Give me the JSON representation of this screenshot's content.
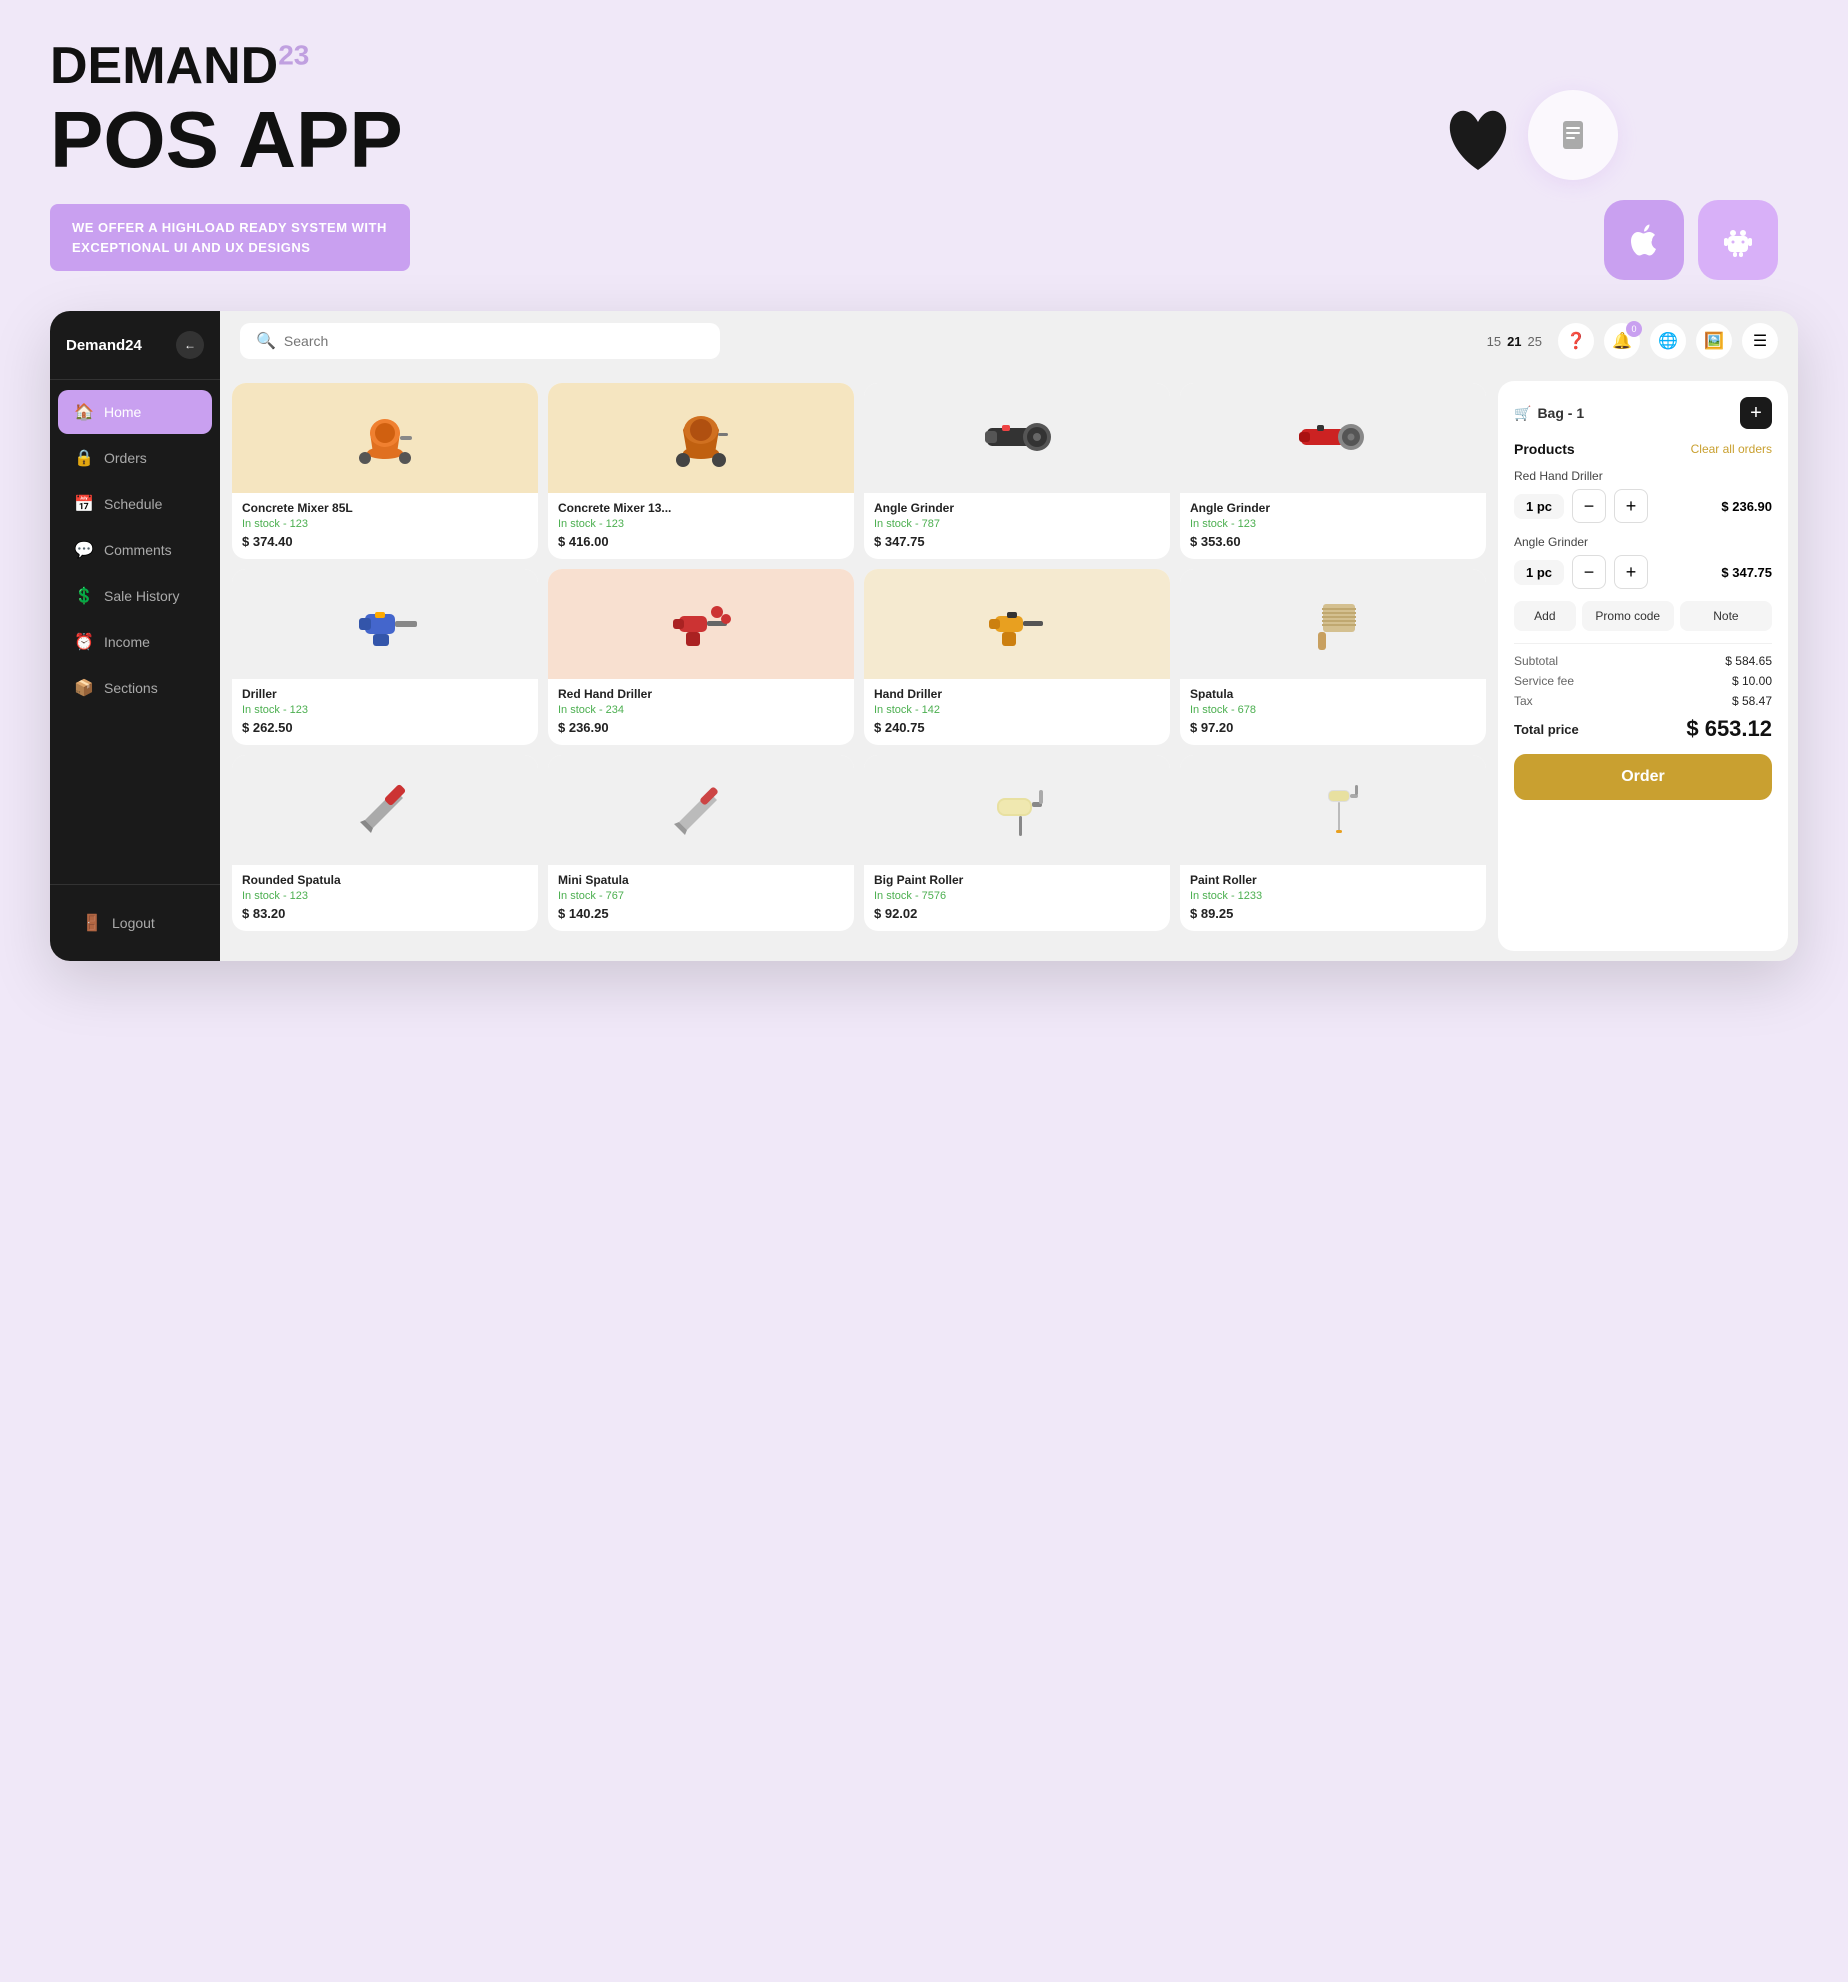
{
  "hero": {
    "brand": "DEMAND",
    "brand_sub": "23",
    "title": "POS APP",
    "tagline": "WE OFFER A HIGHLOAD READY SYSTEM WITH EXCEPTIONAL UI AND UX DESIGNS",
    "apple_icon": "🍎",
    "android_icon": "🤖"
  },
  "app": {
    "sidebar": {
      "brand": "Demand24",
      "nav_items": [
        {
          "id": "home",
          "label": "Home",
          "icon": "🏠",
          "active": true
        },
        {
          "id": "orders",
          "label": "Orders",
          "icon": "🔒"
        },
        {
          "id": "schedule",
          "label": "Schedule",
          "icon": "📅"
        },
        {
          "id": "comments",
          "label": "Comments",
          "icon": "💬"
        },
        {
          "id": "sale-history",
          "label": "Sale History",
          "icon": "💲"
        },
        {
          "id": "income",
          "label": "Income",
          "icon": "⏰"
        },
        {
          "id": "sections",
          "label": "Sections",
          "icon": "📦"
        }
      ],
      "logout_label": "Logout"
    },
    "topbar": {
      "search_placeholder": "Search",
      "pagination": {
        "pages": [
          "15",
          "21",
          "25"
        ],
        "active": "21"
      },
      "notification_count": "0"
    },
    "products": [
      {
        "name": "Concrete Mixer 85L",
        "stock": "In stock - 123",
        "price": "$ 374.40",
        "bg": "orange",
        "emoji": "🔶"
      },
      {
        "name": "Concrete Mixer 13...",
        "stock": "In stock - 123",
        "price": "$ 416.00",
        "bg": "orange",
        "emoji": "🔶"
      },
      {
        "name": "Angle Grinder",
        "stock": "In stock - 787",
        "price": "$ 347.75",
        "bg": "light",
        "emoji": "⚙️"
      },
      {
        "name": "Angle Grinder",
        "stock": "In stock - 123",
        "price": "$ 353.60",
        "bg": "light",
        "emoji": "⚙️"
      },
      {
        "name": "Driller",
        "stock": "In stock - 123",
        "price": "$ 262.50",
        "bg": "light",
        "emoji": "🔧"
      },
      {
        "name": "Red Hand Driller",
        "stock": "In stock - 234",
        "price": "$ 236.90",
        "bg": "peach",
        "emoji": "🔴"
      },
      {
        "name": "Hand Driller",
        "stock": "In stock - 142",
        "price": "$ 240.75",
        "bg": "warm",
        "emoji": "🟡"
      },
      {
        "name": "Spatula",
        "stock": "In stock - 678",
        "price": "$ 97.20",
        "bg": "light",
        "emoji": "🔨"
      },
      {
        "name": "Rounded Spatula",
        "stock": "In stock - 123",
        "price": "$ 83.20",
        "bg": "light",
        "emoji": "🔪"
      },
      {
        "name": "Mini Spatula",
        "stock": "In stock - 767",
        "price": "$ 140.25",
        "bg": "light",
        "emoji": "🔪"
      },
      {
        "name": "Big Paint Roller",
        "stock": "In stock - 7576",
        "price": "$ 92.02",
        "bg": "light",
        "emoji": "🎨"
      },
      {
        "name": "Paint Roller",
        "stock": "In stock - 1233",
        "price": "$ 89.25",
        "bg": "light",
        "emoji": "🖌️"
      }
    ],
    "order_panel": {
      "bag_label": "Bag - 1",
      "products_label": "Products",
      "clear_label": "Clear all orders",
      "items": [
        {
          "name": "Red Hand Driller",
          "qty": "1 pc",
          "price": "$ 236.90"
        },
        {
          "name": "Angle Grinder",
          "qty": "1 pc",
          "price": "$ 347.75"
        }
      ],
      "actions": {
        "add": "Add",
        "promo": "Promo code",
        "note": "Note"
      },
      "subtotal_label": "Subtotal",
      "subtotal_value": "$ 584.65",
      "service_fee_label": "Service fee",
      "service_fee_value": "$ 10.00",
      "tax_label": "Tax",
      "tax_value": "$ 58.47",
      "total_label": "Total price",
      "total_value": "$ 653.12",
      "order_btn": "Order"
    }
  }
}
